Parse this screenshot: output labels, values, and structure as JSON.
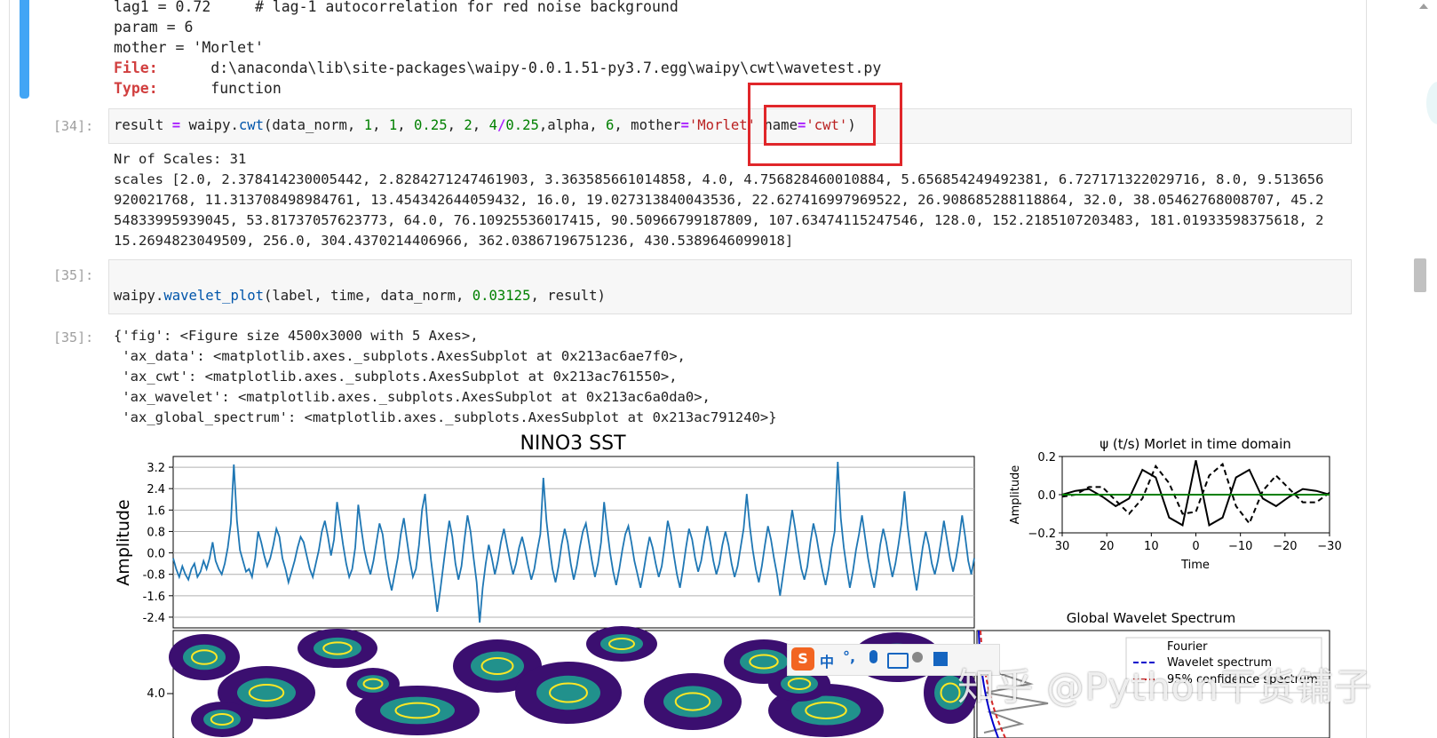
{
  "prev_output": {
    "line0": "lag1 = 0.72     # lag-1 autocorrelation for red noise background",
    "line1": "param = 6",
    "line2": "mother = 'Morlet'",
    "file_label": "File:",
    "file_value": "d:\\anaconda\\lib\\site-packages\\waipy-0.0.1.51-py3.7.egg\\waipy\\cwt\\wavetest.py",
    "type_label": "Type:",
    "type_value": "function"
  },
  "cell34": {
    "prompt": "[34]:",
    "code_a": "result",
    "code_b": " = ",
    "code_c": "waipy.",
    "code_d": "cwt",
    "code_e": "(data_norm, ",
    "n1": "1",
    "sep1": ", ",
    "n2": "1",
    "sep2": ", ",
    "n3": "0.25",
    "sep3": ", ",
    "n4": "2",
    "sep4": ", ",
    "n5": "4",
    "op": "/",
    "n6": "0.25",
    "code_f": ",alpha, ",
    "n7": "6",
    "code_g": ", mother",
    "eq1": "=",
    "s1": "'Morlet'",
    "code_h": " name",
    "eq2": "=",
    "s2": "'cwt'",
    "code_i": ")",
    "out1": "Nr of Scales: 31",
    "out2": "scales [2.0, 2.378414230005442, 2.8284271247461903, 3.363585661014858, 4.0, 4.756828460010884, 5.656854249492381, 6.727171322029716, 8.0, 9.513656",
    "out3": "920021768, 11.313708498984761, 13.454342644059432, 16.0, 19.027313840043536, 22.627416997969522, 26.908685288118864, 32.0, 38.05462768008707, 45.2",
    "out4": "54833995939045, 53.81737057623773, 64.0, 76.10925536017415, 90.50966799187809, 107.63474115247546, 128.0, 152.2185107203483, 181.01933598375618, 2",
    "out5": "15.2694823049509, 256.0, 304.4370214406966, 362.03867196751236, 430.5389646099018]"
  },
  "cell35": {
    "prompt_in": "[35]:",
    "code_a": "waipy.",
    "code_b": "wavelet_plot",
    "code_c": "(label, time, data_norm, ",
    "n1": "0.03125",
    "code_d": ", result)",
    "prompt_out": "[35]:",
    "out1": "{'fig': <Figure size 4500x3000 with 5 Axes>,",
    "out2": " 'ax_data': <matplotlib.axes._subplots.AxesSubplot at 0x213ac6ae7f0>,",
    "out3": " 'ax_cwt': <matplotlib.axes._subplots.AxesSubplot at 0x213ac761550>,",
    "out4": " 'ax_wavelet': <matplotlib.axes._subplots.AxesSubplot at 0x213ac6a0da0>,",
    "out5": " 'ax_global_spectrum': <matplotlib.axes._subplots.AxesSubplot at 0x213ac791240>}"
  },
  "plot_main": {
    "title": "NINO3 SST",
    "ylabel": "Amplitude",
    "yticks": [
      "3.2",
      "2.4",
      "1.6",
      "0.8",
      "0.0",
      "-0.8",
      "-1.6",
      "-2.4"
    ],
    "cwt_ytick": "4.0"
  },
  "plot_wavelet": {
    "title": "ψ (t/s) Morlet in time domain",
    "ylabel": "Amplitude",
    "xlabel": "Time",
    "yticks": [
      "0.2",
      "0.0",
      "−0.2"
    ],
    "xticks": [
      "30",
      "20",
      "10",
      "0",
      "−10",
      "−20",
      "−30"
    ]
  },
  "plot_global": {
    "title": "Global Wavelet Spectrum",
    "legend1": "Wavelet spectrum",
    "legend2": "95% confidence spectrum",
    "legend0": "Fourier"
  },
  "ime": {
    "zh": "中",
    "punct": "°,"
  },
  "watermark": "知乎 @Python干货铺子",
  "colors": {
    "series": "#1f77b4",
    "highlight_box": "#e0262a",
    "selected_cell": "#42a5f5",
    "cwt_dark": "#3b0f70",
    "cwt_mid": "#21918c",
    "cwt_yellow": "#fde725"
  },
  "chart_data": [
    {
      "type": "line",
      "title": "NINO3 SST",
      "xlabel": "",
      "ylabel": "Amplitude",
      "ylim": [
        -2.8,
        3.6
      ],
      "yticks": [
        3.2,
        2.4,
        1.6,
        0.8,
        0.0,
        -0.8,
        -1.6,
        -2.4
      ],
      "grid": true,
      "series": [
        {
          "values": [
            -0.2,
            -0.6,
            -0.9,
            -0.5,
            -0.8,
            -1.0,
            -0.6,
            -0.4,
            -0.9,
            -0.7,
            -0.3,
            -0.6,
            -0.2,
            0.4,
            -0.3,
            -0.6,
            -0.8,
            -0.4,
            0.2,
            1.1,
            3.3,
            1.2,
            0.1,
            -0.3,
            -0.7,
            -0.6,
            -0.9,
            -0.2,
            0.8,
            0.4,
            -0.1,
            -0.5,
            -0.2,
            0.3,
            0.9,
            0.6,
            -0.2,
            -0.6,
            -1.1,
            -0.7,
            -0.3,
            0.2,
            0.6,
            0.4,
            -0.1,
            -0.6,
            -0.9,
            -0.4,
            0.1,
            0.8,
            1.2,
            0.6,
            -0.1,
            0.5,
            1.9,
            1.1,
            0.3,
            -0.4,
            -0.9,
            -0.6,
            0.2,
            1.8,
            0.9,
            0.1,
            -0.4,
            -0.8,
            -0.3,
            0.4,
            1.1,
            0.7,
            -0.2,
            -0.9,
            -1.4,
            -0.8,
            -0.2,
            0.7,
            1.3,
            0.5,
            -0.3,
            -0.9,
            -0.6,
            0.3,
            1.6,
            2.2,
            0.8,
            -0.3,
            -1.2,
            -2.2,
            -1.4,
            -0.5,
            0.4,
            1.2,
            0.6,
            -0.4,
            -1.0,
            -0.5,
            0.5,
            1.4,
            0.8,
            -0.2,
            -1.1,
            -2.6,
            -1.3,
            -0.4,
            0.3,
            -0.2,
            -0.8,
            -0.3,
            0.4,
            0.9,
            0.3,
            -0.3,
            -0.8,
            -0.4,
            0.2,
            0.6,
            0.1,
            -0.5,
            -1.0,
            -0.6,
            0.1,
            0.7,
            2.8,
            1.2,
            0.2,
            -0.6,
            -1.1,
            -0.5,
            0.3,
            0.9,
            0.4,
            -0.4,
            -1.0,
            -0.5,
            0.2,
            0.8,
            1.1,
            0.4,
            -0.3,
            -0.9,
            -0.4,
            0.4,
            1.9,
            0.9,
            0.0,
            -0.7,
            -1.2,
            -0.6,
            0.1,
            0.7,
            1.0,
            0.4,
            -0.3,
            -0.8,
            -1.3,
            -0.7,
            0.0,
            0.6,
            0.2,
            -0.4,
            -0.9,
            -0.5,
            0.3,
            1.2,
            0.7,
            -0.1,
            -0.8,
            -1.3,
            -0.6,
            0.2,
            0.9,
            0.5,
            -0.2,
            -0.7,
            -0.3,
            0.4,
            1.0,
            0.4,
            -0.3,
            -0.8,
            -0.4,
            0.3,
            0.8,
            0.3,
            -0.4,
            -0.9,
            -0.5,
            0.2,
            0.9,
            2.2,
            1.0,
            0.1,
            -0.6,
            -1.1,
            -0.5,
            0.3,
            1.0,
            0.5,
            -0.2,
            -0.8,
            -1.6,
            -0.8,
            0.0,
            0.8,
            1.6,
            0.9,
            0.1,
            -0.6,
            -1.0,
            -0.5,
            0.4,
            1.1,
            0.6,
            -0.1,
            -0.7,
            -1.2,
            -0.6,
            0.2,
            0.8,
            3.4,
            1.3,
            0.2,
            -0.6,
            -1.3,
            -0.7,
            0.1,
            0.7,
            1.4,
            0.6,
            -0.2,
            -0.8,
            -1.3,
            -0.6,
            0.3,
            0.9,
            0.4,
            -0.3,
            -0.9,
            -0.4,
            0.3,
            1.1,
            2.3,
            1.0,
            0.1,
            -0.7,
            -1.4,
            -0.6,
            0.2,
            0.8,
            0.3,
            -0.4,
            -0.8,
            -0.3,
            0.4,
            1.2,
            0.5,
            -0.2,
            -0.7,
            -0.2,
            0.5,
            1.4,
            0.6,
            -0.3,
            -0.8,
            -0.2
          ]
        }
      ]
    },
    {
      "type": "line",
      "title": "ψ (t/s) Morlet in time domain",
      "xlabel": "Time",
      "ylabel": "Amplitude",
      "xlim": [
        30,
        -30
      ],
      "ylim": [
        -0.2,
        0.2
      ],
      "series": [
        {
          "style": "solid",
          "color": "#000000",
          "x": [
            30,
            27,
            24,
            21,
            18,
            15,
            12,
            9,
            6,
            3,
            0,
            -3,
            -6,
            -9,
            -12,
            -15,
            -18,
            -21,
            -24,
            -27,
            -30
          ],
          "values": [
            0.0,
            0.02,
            0.03,
            -0.01,
            -0.06,
            -0.02,
            0.13,
            0.09,
            -0.12,
            -0.16,
            0.18,
            -0.16,
            -0.12,
            0.09,
            0.13,
            -0.02,
            -0.06,
            -0.01,
            0.03,
            0.02,
            0.0
          ]
        },
        {
          "style": "dashed",
          "color": "#000000",
          "x": [
            30,
            27,
            24,
            21,
            18,
            15,
            12,
            9,
            6,
            3,
            0,
            -3,
            -6,
            -9,
            -12,
            -15,
            -18,
            -21,
            -24,
            -27,
            -30
          ],
          "values": [
            -0.01,
            0.0,
            0.04,
            0.04,
            -0.03,
            -0.1,
            -0.02,
            0.15,
            0.06,
            -0.1,
            -0.09,
            0.1,
            0.16,
            -0.06,
            -0.15,
            0.02,
            0.1,
            0.03,
            -0.04,
            -0.04,
            0.01
          ]
        },
        {
          "style": "solid",
          "color": "#008000",
          "x": [
            30,
            -30
          ],
          "values": [
            0.0,
            0.0
          ]
        }
      ]
    }
  ]
}
